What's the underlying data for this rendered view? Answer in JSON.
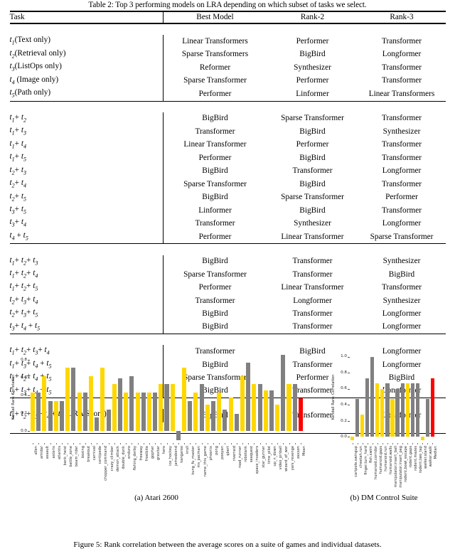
{
  "table": {
    "caption": "Table 2: Top 3 performing models on LRA depending on which subset of tasks we select.",
    "headers": [
      "Task",
      "Best Model",
      "Rank-2",
      "Rank-3"
    ],
    "groups": [
      {
        "rows": [
          {
            "task_main": "(Text only)",
            "task_sub": "1",
            "best": "Linear Transformers",
            "rank2": "Performer",
            "rank3": "Transformer"
          },
          {
            "task_main": "(Retrieval only)",
            "task_sub": "2",
            "best": "Sparse Transformers",
            "rank2": "BigBird",
            "rank3": "Longformer"
          },
          {
            "task_main": "(ListOps only)",
            "task_sub": "3",
            "best": "Reformer",
            "rank2": "Synthesizer",
            "rank3": "Transformer"
          },
          {
            "task_main": " (Image only)",
            "task_sub": "4",
            "best": "Sparse Transformer",
            "rank2": "Performer",
            "rank3": "Transformer"
          },
          {
            "task_main": "(Path only)",
            "task_sub": "5",
            "best": "Performer",
            "rank2": "Linformer",
            "rank3": "Linear Transformers"
          }
        ]
      },
      {
        "rows": [
          {
            "task": "t1+ t2",
            "best": "BigBird",
            "rank2": "Sparse Transformer",
            "rank3": "Transformer"
          },
          {
            "task": "t1+ t3",
            "best": "Transformer",
            "rank2": "BigBird",
            "rank3": "Synthesizer"
          },
          {
            "task": "t1+ t4",
            "best": "Linear Transformer",
            "rank2": "Performer",
            "rank3": "Transformer"
          },
          {
            "task": "t1+ t5",
            "best": "Performer",
            "rank2": "BigBird",
            "rank3": "Transformer"
          },
          {
            "task": "t2+ t3",
            "best": "BigBird",
            "rank2": "Transformer",
            "rank3": "Longformer"
          },
          {
            "task": "t2+ t4",
            "best": "Sparse Transformer",
            "rank2": "BigBird",
            "rank3": "Transformer"
          },
          {
            "task": "t2+ t5",
            "best": "BigBird",
            "rank2": "Sparse Transformer",
            "rank3": "Performer"
          },
          {
            "task": "t3+ t5",
            "best": "Linformer",
            "rank2": "BigBird",
            "rank3": "Transformer"
          },
          {
            "task": "t3+ t4",
            "best": "Transformer",
            "rank2": "Synthesizer",
            "rank3": "Longformer"
          },
          {
            "task": "t4 + t5",
            "best": "Performer",
            "rank2": "Linear Transformer",
            "rank3": "Sparse Transformer"
          }
        ]
      },
      {
        "rows": [
          {
            "task": "t1+ t2+ t3",
            "best": "BigBird",
            "rank2": "Transformer",
            "rank3": "Synthesizer"
          },
          {
            "task": "t1+ t2+ t4",
            "best": "Sparse Transformer",
            "rank2": "Transformer",
            "rank3": "BigBird"
          },
          {
            "task": "t1+ t2+ t5",
            "best": "Performer",
            "rank2": "Linear Transformer",
            "rank3": "Transformer"
          },
          {
            "task": "t2+ t3+ t4",
            "best": "Transformer",
            "rank2": "Longformer",
            "rank3": "Synthesizer"
          },
          {
            "task": "t2+ t3+ t5",
            "best": "BigBird",
            "rank2": "Transformer",
            "rank3": "Longformer"
          },
          {
            "task": "t3+ t4 + t5",
            "best": "BigBird",
            "rank2": "Transformer",
            "rank3": "Longformer"
          }
        ]
      },
      {
        "rows": [
          {
            "task": "t1+ t2+ t3+ t4",
            "best": "Transformer",
            "rank2": "BigBird",
            "rank3": "Longformer"
          },
          {
            "task": "t1+ t3+ t4 + t5",
            "best": "BigBird",
            "rank2": "Transformer",
            "rank3": "Longformer"
          },
          {
            "task": "t1+ t2+ t4 + t5",
            "best": "Sparse Transformer",
            "rank2": "Performer",
            "rank3": "BigBird"
          },
          {
            "task": "t2+ t3+ t4 + t5",
            "best": "BigBird",
            "rank2": "Transformer",
            "rank3": "Longformer"
          }
        ]
      },
      {
        "rows": [
          {
            "task": "t1+ t2+ t3+ t4 + t5 (LRA Score)",
            "best": "BigBird",
            "rank2": "Transformer",
            "rank3": "Longformer"
          }
        ]
      }
    ]
  },
  "figure": {
    "subcaption_a": "(a) Atari 2600",
    "subcaption_b": "(b) DM Control Suite",
    "caption": "Figure 5: Rank correlation between the average scores on a suite of games and individual datasets.",
    "colors": {
      "yellow": "#FFD700",
      "gray": "#808080",
      "red": "#FF0000",
      "axis": "#444444"
    }
  },
  "chart_data": [
    {
      "type": "bar",
      "title": "(a) Atari 2600",
      "xlabel": "",
      "ylabel": "Kendall Rank Correlation",
      "ylim": [
        -0.12,
        0.88
      ],
      "yticks": [
        "0.0",
        "0.2",
        "0.4",
        "0.6",
        "0.8"
      ],
      "ytickvals": [
        0.0,
        0.2,
        0.4,
        0.6,
        0.8
      ],
      "grid": false,
      "legend": "none",
      "categories": [
        "allen",
        "amidar",
        "assault",
        "asterix",
        "atlantis",
        "bank_heist",
        "battle_zone",
        "beam_rider",
        "boxing",
        "breakout",
        "carnival",
        "centipede",
        "chopper_command",
        "crazy_climber",
        "demon_attack",
        "double_dunk",
        "enduro",
        "fishing_derby",
        "freeway",
        "frostbite",
        "gopher",
        "gravitar",
        "hero",
        "ice_hockey",
        "jamesbond",
        "kangaroo",
        "krull",
        "kung_fu_master",
        "ms_pacman",
        "name_this_game",
        "phoenix",
        "pong",
        "pooyan",
        "qbert",
        "riverraid",
        "road_runner",
        "robotank",
        "seaquest",
        "space_invaders",
        "star_gunner",
        "time_pilot",
        "up_n_down",
        "video_pinball",
        "wizard_of_wor",
        "yars_revenge",
        "zaxxon",
        "Mean"
      ],
      "values": [
        0.43,
        0.43,
        0.62,
        0.34,
        0.34,
        0.34,
        0.71,
        0.71,
        0.43,
        0.43,
        0.62,
        0.15,
        0.71,
        0.24,
        0.53,
        0.59,
        0.43,
        0.62,
        0.43,
        0.43,
        0.43,
        0.43,
        0.53,
        0.53,
        0.53,
        -0.1,
        0.71,
        0.34,
        0.43,
        0.53,
        0.3,
        0.34,
        0.43,
        0.24,
        0.38,
        0.19,
        0.62,
        0.77,
        0.53,
        0.53,
        0.46,
        0.46,
        0.3,
        0.86,
        0.53,
        0.53,
        0.37
      ],
      "bar_colors": [
        "yellow",
        "gray",
        "yellow",
        "gray",
        "yellow",
        "gray",
        "yellow",
        "gray",
        "yellow",
        "gray",
        "yellow",
        "gray",
        "yellow",
        "gray",
        "yellow",
        "gray",
        "yellow",
        "gray",
        "yellow",
        "gray",
        "yellow",
        "gray",
        "yellow",
        "gray",
        "yellow",
        "gray",
        "yellow",
        "gray",
        "yellow",
        "gray",
        "yellow",
        "gray",
        "yellow",
        "gray",
        "yellow",
        "gray",
        "yellow",
        "gray",
        "yellow",
        "gray",
        "yellow",
        "gray",
        "yellow",
        "gray",
        "yellow",
        "gray",
        "red"
      ]
    },
    {
      "type": "bar",
      "title": "(b) DM Control Suite",
      "xlabel": "",
      "ylabel": "Kendall Rank Correlation",
      "ylim": [
        -0.06,
        1.05
      ],
      "yticks": [
        "0.0",
        "0.2",
        "0.4",
        "0.6",
        "0.8",
        "1.0"
      ],
      "ytickvals": [
        0.0,
        0.2,
        0.4,
        0.6,
        0.8,
        1.0
      ],
      "grid": false,
      "legend": "none",
      "categories": [
        "cartpole.swingup",
        "cheetah.run",
        "finger.turn_hard",
        "fish.swim",
        "humanoid.corridor",
        "humanoid.gaps",
        "humanoid.run",
        "humanoid.walls",
        "manipulator.insert_ball",
        "manipulator.insert_peg",
        "rodent.bowl_escape",
        "rodent.gaps",
        "rodent.mazes",
        "rodent.two_tap",
        "walker.stand",
        "walker.walk",
        "Median"
      ],
      "values": [
        -0.04,
        0.47,
        0.28,
        0.73,
        1.0,
        0.67,
        0.6,
        0.67,
        0.47,
        0.6,
        0.67,
        0.67,
        0.67,
        0.67,
        -0.04,
        0.47,
        0.73
      ],
      "bar_colors": [
        "yellow",
        "gray",
        "yellow",
        "gray",
        "gray",
        "yellow",
        "yellow",
        "gray",
        "yellow",
        "gray",
        "gray",
        "yellow",
        "gray",
        "gray",
        "yellow",
        "gray",
        "red"
      ]
    }
  ]
}
